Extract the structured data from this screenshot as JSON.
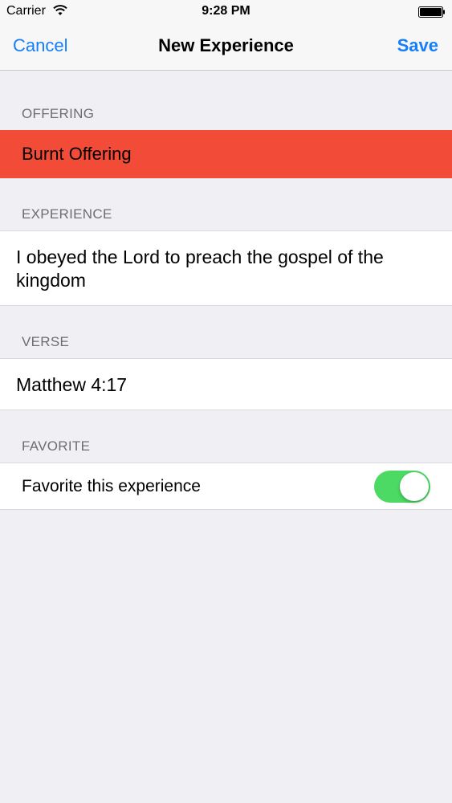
{
  "status_bar": {
    "carrier": "Carrier",
    "time": "9:28 PM"
  },
  "nav": {
    "cancel_label": "Cancel",
    "title": "New Experience",
    "save_label": "Save"
  },
  "sections": {
    "offering": {
      "header": "OFFERING",
      "value": "Burnt Offering",
      "color": "#f24b37"
    },
    "experience": {
      "header": "EXPERIENCE",
      "value": "I obeyed the Lord to preach the gospel of the kingdom"
    },
    "verse": {
      "header": "VERSE",
      "value": "Matthew 4:17"
    },
    "favorite": {
      "header": "FAVORITE",
      "label": "Favorite this experience",
      "toggle_on": true,
      "toggle_color": "#4cd964"
    }
  },
  "colors": {
    "accent": "#157efb",
    "background": "#efeff4"
  },
  "icons": {
    "wifi": "wifi-icon",
    "battery": "battery-icon"
  }
}
